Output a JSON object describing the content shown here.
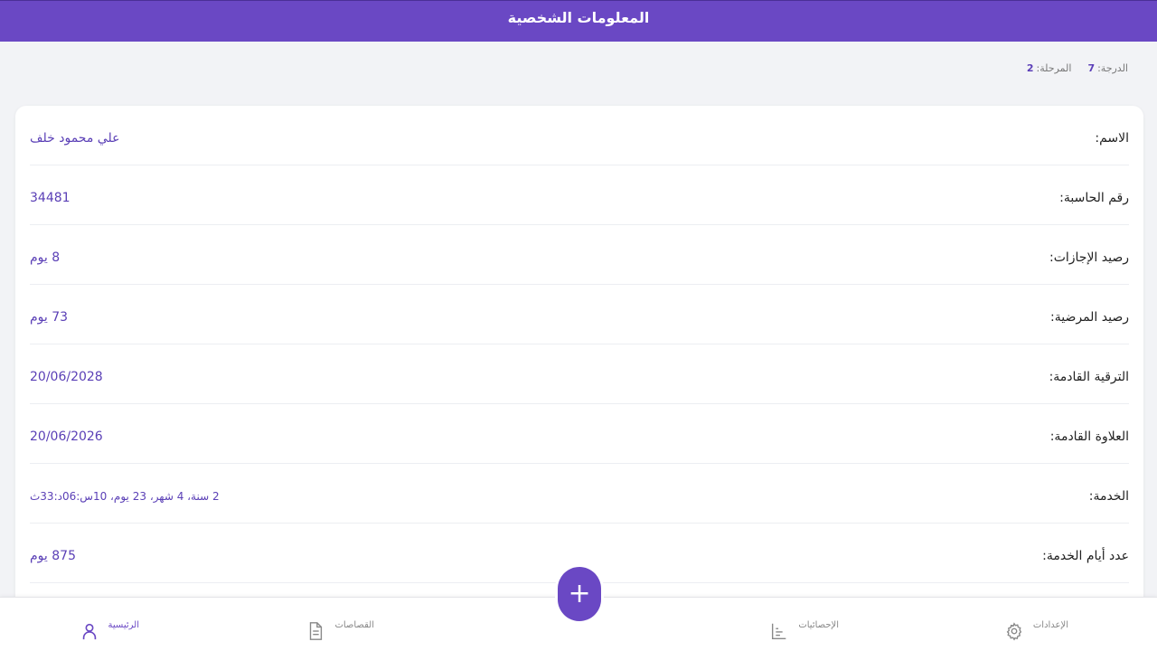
{
  "header": {
    "title": "المعلومات الشخصية"
  },
  "meta": {
    "grade_label": "الدرجة:",
    "grade_value": "7",
    "stage_label": "المرحلة:",
    "stage_value": "2"
  },
  "info": [
    {
      "label": "الاسم:",
      "value": "علي محمود خلف"
    },
    {
      "label": "رقم الحاسبة:",
      "value": "34481"
    },
    {
      "label": "رصيد الإجازات:",
      "value": "8 يوم"
    },
    {
      "label": "رصيد المرضية:",
      "value": "73 يوم"
    },
    {
      "label": "الترقية القادمة:",
      "value": "20/06/2028"
    },
    {
      "label": "العلاوة القادمة:",
      "value": "20/06/2026"
    },
    {
      "label": "الخدمة:",
      "value": "2 سنة، 4 شهر، 23 يوم، 10س:06د:33ث"
    },
    {
      "label": "عدد أيام الخدمة:",
      "value": "875 يوم"
    }
  ],
  "nav": {
    "settings": "الإعدادات",
    "stats": "الإحصائيات",
    "deductions": "القصاصات",
    "home": "الرئيسية"
  },
  "fab": {
    "symbol": "+"
  },
  "colors": {
    "primary": "#6a48c4",
    "accent_text": "#5a3fb6"
  }
}
